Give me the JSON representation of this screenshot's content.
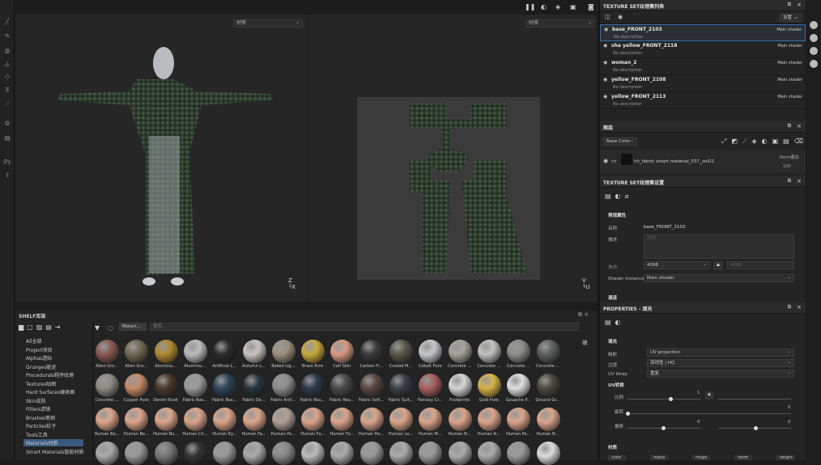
{
  "viewport": {
    "left_select": "材质",
    "right_select": "材质"
  },
  "toolbar_icons": [
    "brush-icon",
    "eraser-icon",
    "projection-icon",
    "geometry-icon",
    "picker-icon",
    "clone-icon",
    "smudge-icon",
    "settings-icon",
    "layers-icon",
    "ps-icon",
    "export-icon"
  ],
  "texture_set_list": {
    "title": "TEXTURE SET纹理集列表",
    "settings_label": "设置 ⌄",
    "items": [
      {
        "name": "base_FRONT_2103",
        "desc": "No description",
        "shader": "Main shader"
      },
      {
        "name": "sha yellow_FRONT_2118",
        "desc": "No description",
        "shader": "Main shader"
      },
      {
        "name": "woman_2",
        "desc": "No description",
        "shader": "Main shader"
      },
      {
        "name": "yellow_FRONT_2108",
        "desc": "No description",
        "shader": "Main shader"
      },
      {
        "name": "yellow_FRONT_2113",
        "desc": "No description",
        "shader": "Main shader"
      }
    ]
  },
  "layers": {
    "title": "图层",
    "channel": "Base Color",
    "layer_name": "hh_fabric smart material_037_vol02",
    "blend": "Norm叠加",
    "opacity": "100"
  },
  "ts_settings": {
    "title": "TEXTURE SET纹理集设置",
    "section": "常规属性",
    "name_label": "名称",
    "name_value": "base_FRONT_2103",
    "desc_label": "描述",
    "desc_placeholder": "描述",
    "size_label": "大小",
    "size_value": "4096",
    "size_value2": "4096",
    "shader_label": "Shader Instance",
    "shader_value": "Main shader",
    "channels_label": "通道"
  },
  "properties": {
    "title": "PROPERTIES - 填充",
    "fill": "填充",
    "proj_label": "映射",
    "proj_value": "UV projection",
    "filter_label": "过滤",
    "filter_value": "双线性 | HQ",
    "wrap_label": "UV Wrap",
    "wrap_value": "重复",
    "uv_section": "UV转换",
    "scale_label": "比例",
    "scale_value": "1",
    "rot_label": "旋转",
    "rot_value": "0",
    "offset_label": "偏移",
    "off1": "0",
    "off2": "0",
    "material_label": "材质"
  },
  "shelf": {
    "title": "SHELF库架",
    "search_tag": "Materi...",
    "search_placeholder": "搜索...",
    "categories": [
      "All全部",
      "Project项目",
      "Alphas透贴",
      "Grunges脏迹",
      "Procedurals程序纹理",
      "Textures贴图",
      "Hard Surfaces硬表面",
      "Skin皮肤",
      "Filters滤镜",
      "Brushes笔刷",
      "Particles粒子",
      "Tools工具",
      "Materials材质",
      "Smart Materials智能材质"
    ],
    "active_category": "Materials材质",
    "rows": [
      [
        {
          "n": "Alien Gro...",
          "c": "#8a5a52"
        },
        {
          "n": "Alien Gro...",
          "c": "#6e6a55"
        },
        {
          "n": "Aluminiu...",
          "c": "#b08a30"
        },
        {
          "n": "Aluminiu...",
          "c": "#bdbdbd"
        },
        {
          "n": "Artificial L...",
          "c": "#2c2c2c"
        },
        {
          "n": "Autumn L...",
          "c": "#c9c4bd"
        },
        {
          "n": "Baked Lig...",
          "c": "#9c8f7e"
        },
        {
          "n": "Brass Pure",
          "c": "#c9a93c"
        },
        {
          "n": "Calf Skin",
          "c": "#d79a82"
        },
        {
          "n": "Carbon Fi...",
          "c": "#3a3a3a"
        },
        {
          "n": "Coated M...",
          "c": "#5a584a"
        },
        {
          "n": "Cobalt Pure",
          "c": "#c6c8cc"
        },
        {
          "n": "Concrete ...",
          "c": "#a7a39a"
        },
        {
          "n": "Concrete ...",
          "c": "#c2c2c0"
        },
        {
          "n": "Concrete ...",
          "c": "#8d8d8b"
        },
        {
          "n": "Concrete ...",
          "c": "#5e5f5f"
        }
      ],
      [
        {
          "n": "Concrete ...",
          "c": "#8e8a84"
        },
        {
          "n": "Copper Pure",
          "c": "#c58b68"
        },
        {
          "n": "Denim Rivet",
          "c": "#4a3a2a"
        },
        {
          "n": "Fabric Bas...",
          "c": "#9b9b9b"
        },
        {
          "n": "Fabric Bas...",
          "c": "#2e4658"
        },
        {
          "n": "Fabric De...",
          "c": "#26343c"
        },
        {
          "n": "Fabric Knit...",
          "c": "#8d8d8d"
        },
        {
          "n": "Fabric Rou...",
          "c": "#2e3a4c"
        },
        {
          "n": "Fabric Rou...",
          "c": "#4a4a4a"
        },
        {
          "n": "Fabric Soft...",
          "c": "#5a4844"
        },
        {
          "n": "Fabric Suit...",
          "c": "#394048"
        },
        {
          "n": "Fantasy Cr...",
          "c": "#a8605e"
        },
        {
          "n": "Footprints",
          "c": "#d6d6d6"
        },
        {
          "n": "Gold Pure",
          "c": "#d6b346"
        },
        {
          "n": "Gouache P...",
          "c": "#e0e0e0"
        },
        {
          "n": "Ground Gr...",
          "c": "#4c4a40"
        }
      ],
      [
        {
          "n": "Human Ba...",
          "c": "#dba48a"
        },
        {
          "n": "Human Be...",
          "c": "#dba48a"
        },
        {
          "n": "Human Bu...",
          "c": "#dba48a"
        },
        {
          "n": "Human Ch...",
          "c": "#dba48a"
        },
        {
          "n": "Human Ey...",
          "c": "#dba48a"
        },
        {
          "n": "Human Fa...",
          "c": "#dba48a"
        },
        {
          "n": "Human Fe...",
          "c": "#b0a096"
        },
        {
          "n": "Human Fo...",
          "c": "#dba48a"
        },
        {
          "n": "Human Fo...",
          "c": "#dba48a"
        },
        {
          "n": "Human He...",
          "c": "#dba48a"
        },
        {
          "n": "Human Le...",
          "c": "#dba48a"
        },
        {
          "n": "Human M...",
          "c": "#dba48a"
        },
        {
          "n": "Human N...",
          "c": "#dba48a"
        },
        {
          "n": "Human N...",
          "c": "#dba48a"
        },
        {
          "n": "Human Pa...",
          "c": "#dba48a"
        },
        {
          "n": "Human N...",
          "c": "#dba48a"
        }
      ],
      [
        {
          "n": "",
          "c": "#aaa"
        },
        {
          "n": "",
          "c": "#999"
        },
        {
          "n": "",
          "c": "#777"
        },
        {
          "n": "",
          "c": "#333"
        },
        {
          "n": "",
          "c": "#999"
        },
        {
          "n": "",
          "c": "#aaa"
        },
        {
          "n": "",
          "c": "#888"
        },
        {
          "n": "",
          "c": "#bbb"
        },
        {
          "n": "",
          "c": "#aaa"
        },
        {
          "n": "",
          "c": "#999"
        },
        {
          "n": "",
          "c": "#aaa"
        },
        {
          "n": "",
          "c": "#999"
        },
        {
          "n": "",
          "c": "#aaa"
        },
        {
          "n": "",
          "c": "#aaa"
        },
        {
          "n": "",
          "c": "#999"
        },
        {
          "n": "",
          "c": "#ddd"
        }
      ]
    ]
  },
  "material_buttons": [
    "color",
    "metal",
    "rough",
    "norm",
    "height"
  ]
}
